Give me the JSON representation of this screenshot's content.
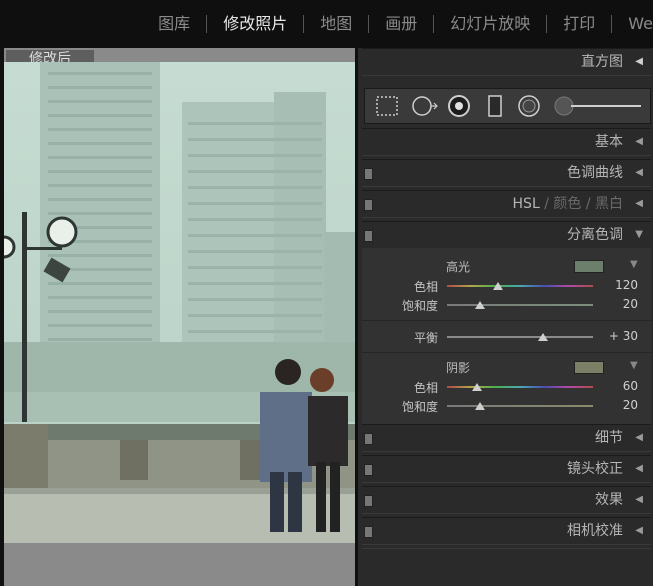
{
  "top_nav": {
    "items": [
      {
        "label": "图库",
        "active": false
      },
      {
        "label": "修改照片",
        "active": true
      },
      {
        "label": "地图",
        "active": false
      },
      {
        "label": "画册",
        "active": false
      },
      {
        "label": "幻灯片放映",
        "active": false
      },
      {
        "label": "打印",
        "active": false
      },
      {
        "label": "We",
        "active": false
      }
    ]
  },
  "viewer": {
    "label": "修改后"
  },
  "panel": {
    "histogram": "直方图",
    "basic": "基本",
    "tone_curve": "色调曲线",
    "hsl": {
      "hsl": "HSL",
      "sep1": "/",
      "color": "颜色",
      "sep2": "/",
      "bw": "黑白"
    },
    "split_toning": {
      "title": "分离色调",
      "highlights": {
        "label": "高光",
        "swatch_color": "#6b7f6c",
        "hue_label": "色相",
        "hue_value": "120",
        "sat_label": "饱和度",
        "sat_value": "20"
      },
      "balance": {
        "label": "平衡",
        "value": "+ 30"
      },
      "shadows": {
        "label": "阴影",
        "swatch_color": "#7b7f66",
        "hue_label": "色相",
        "hue_value": "60",
        "sat_label": "饱和度",
        "sat_value": "20"
      }
    },
    "detail": "细节",
    "lens": "镜头校正",
    "effects": "效果",
    "camera": "相机校准"
  },
  "icons": {
    "histogram_collapse": "◀",
    "section_collapsed": "◀",
    "section_expanded": "▼"
  }
}
